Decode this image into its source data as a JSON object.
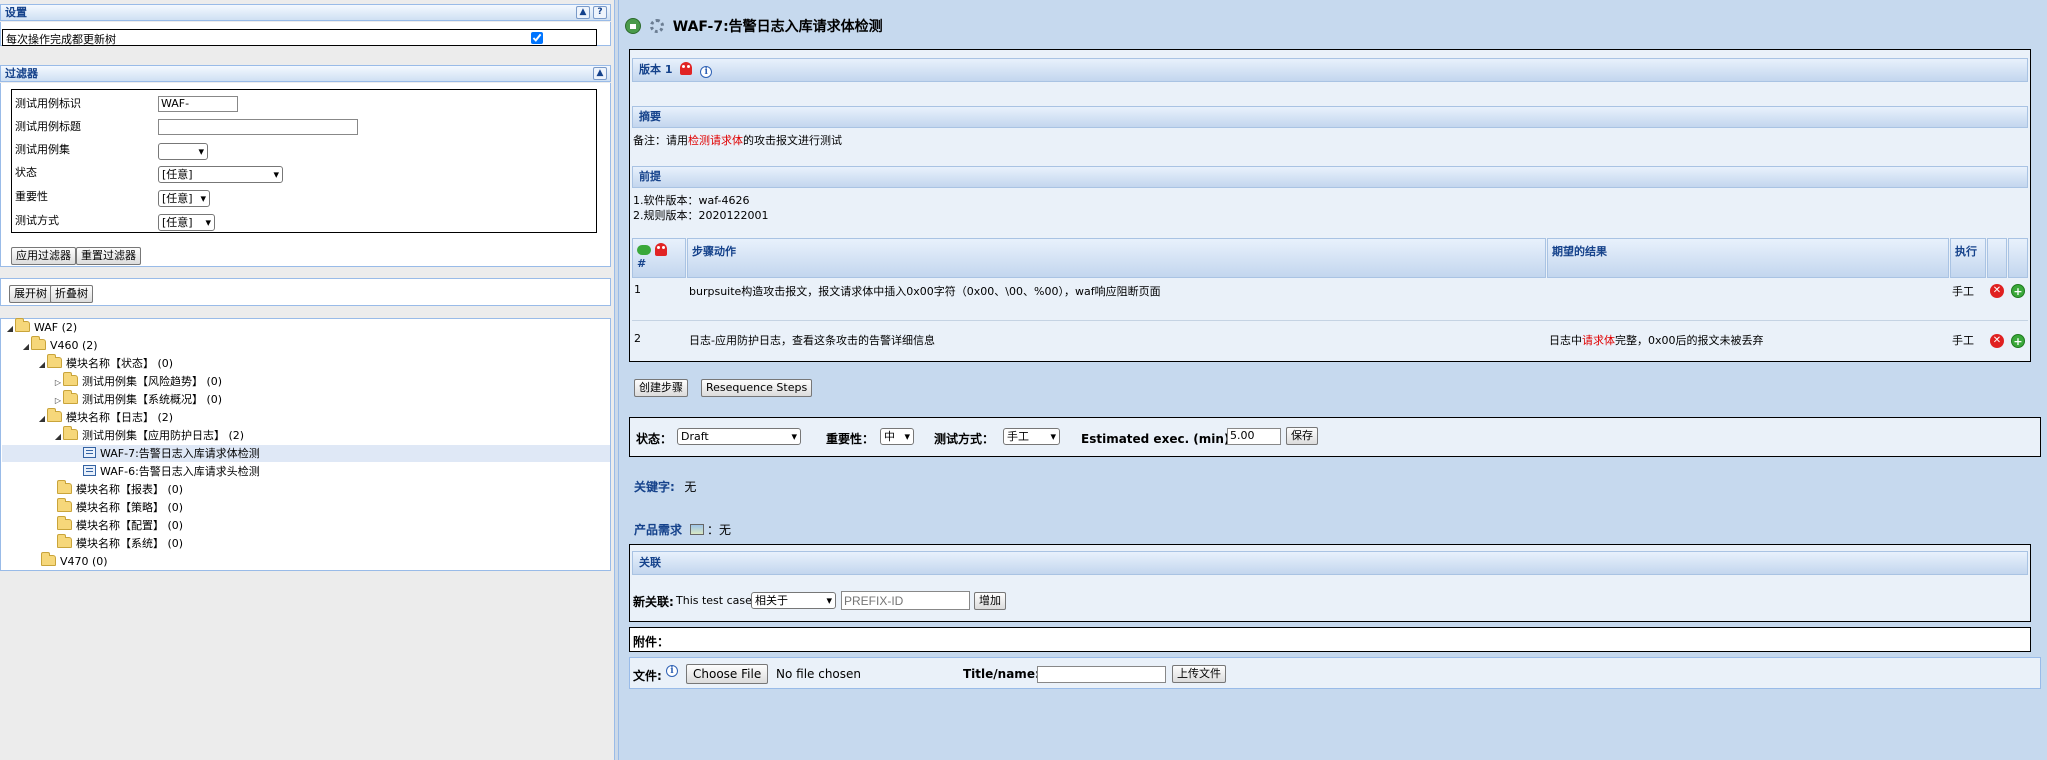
{
  "left": {
    "settings": {
      "title": "设置",
      "update_tree_label": "每次操作完成都更新树",
      "update_tree_checked": true
    },
    "filter": {
      "title": "过滤器",
      "fields": {
        "tc_id_label": "测试用例标识",
        "tc_id_value": "WAF-",
        "tc_title_label": "测试用例标题",
        "tc_suite_label": "测试用例集",
        "status_label": "状态",
        "status_value": "[任意]",
        "importance_label": "重要性",
        "importance_value": "[任意]",
        "exec_type_label": "测试方式",
        "exec_type_value": "[任意]"
      },
      "apply_button": "应用过滤器",
      "reset_button": "重置过滤器"
    },
    "tree_controls": {
      "expand": "展开树",
      "collapse": "折叠树"
    },
    "tree": {
      "nodes": [
        "WAF (2)",
        "V460 (2)",
        "模块名称【状态】 (0)",
        "测试用例集【风险趋势】 (0)",
        "测试用例集【系统概况】 (0)",
        "模块名称【日志】 (2)",
        "测试用例集【应用防护日志】 (2)",
        "WAF-7:告警日志入库请求体检测",
        "WAF-6:告警日志入库请求头检测",
        "模块名称【报表】 (0)",
        "模块名称【策略】 (0)",
        "模块名称【配置】 (0)",
        "模块名称【系统】 (0)",
        "V470 (0)"
      ]
    }
  },
  "right": {
    "title": "WAF-7:告警日志入库请求体检测",
    "version_label": "版本 1",
    "summary_title": "摘要",
    "summary": {
      "prefix": "备注：请用",
      "highlight": "检测请求体",
      "suffix": "的攻击报文进行测试"
    },
    "preconditions_title": "前提",
    "preconditions": [
      "1.软件版本：waf-4626",
      "2.规则版本：2020122001"
    ],
    "steps_table": {
      "col_num": "#",
      "col_action": "步骤动作",
      "col_expected": "期望的结果",
      "col_exec": "执行",
      "rows": [
        {
          "num": "1",
          "action": "burpsuite构造攻击报文，报文请求体中插入0x00字符（0x00、\\00、%00），waf响应阻断页面",
          "expected_prefix": "",
          "expected_highlight": "",
          "expected_suffix": "",
          "exec": "手工"
        },
        {
          "num": "2",
          "action": "日志-应用防护日志，查看这条攻击的告警详细信息",
          "expected_prefix": "日志中",
          "expected_highlight": "请求体",
          "expected_suffix": "完整，0x00后的报文未被丢弃",
          "exec": "手工"
        }
      ]
    },
    "create_step_button": "创建步骤",
    "resequence_button": "Resequence Steps",
    "attributes": {
      "status_label": "状态：",
      "status_value": "Draft",
      "importance_label": "重要性：",
      "importance_value": "中",
      "exec_type_label": "测试方式：",
      "exec_type_value": "手工",
      "estimated_label": "Estimated exec. (min)：",
      "estimated_value": "5.00",
      "save_button": "保存"
    },
    "keywords": {
      "label": "关键字:",
      "value": "无"
    },
    "requirements": {
      "label": "产品需求",
      "value": "：无"
    },
    "relations": {
      "title": "关联",
      "new_label": "新关联:",
      "this_case": "This test case",
      "relation_type": "相关于",
      "id_placeholder": "PREFIX-ID",
      "add_button": "增加"
    },
    "attachments": {
      "label": "附件："
    },
    "upload": {
      "file_label": "文件:",
      "choose_button": "Choose File",
      "no_file": "No file chosen",
      "title_label": "Title/name:",
      "upload_button": "上传文件"
    }
  },
  "colors": {
    "panel_border": "#99bbe8",
    "header_text": "#15428b",
    "right_bg": "#c6d9ee",
    "highlight_red": "#e00000"
  }
}
